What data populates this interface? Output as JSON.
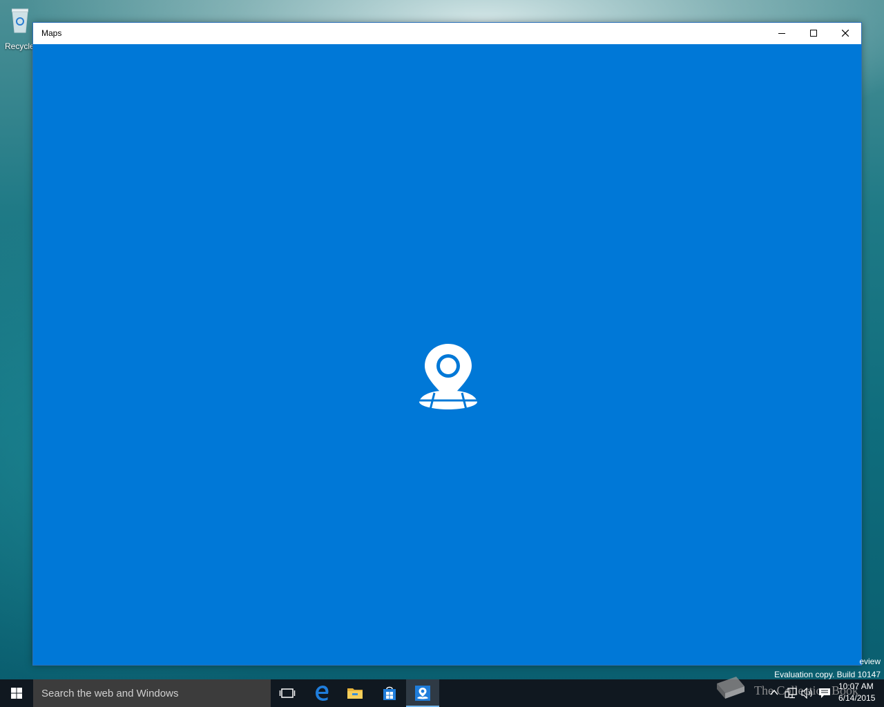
{
  "desktop": {
    "recycle_bin_label": "Recycle"
  },
  "window": {
    "title": "Maps",
    "caption_buttons": {
      "minimize_icon": "minimize-icon",
      "maximize_icon": "maximize-icon",
      "close_icon": "close-icon"
    },
    "splash_icon": "maps-logo-icon",
    "background_color": "#0078d7"
  },
  "watermark": {
    "edge_text": "eview",
    "build_text": "Evaluation copy. Build 10147"
  },
  "taskbar": {
    "search_placeholder": "Search the web and Windows",
    "pinned": [
      {
        "name": "Task View",
        "icon": "task-view-icon"
      },
      {
        "name": "Microsoft Edge",
        "icon": "edge-icon"
      },
      {
        "name": "File Explorer",
        "icon": "folder-icon"
      },
      {
        "name": "Store",
        "icon": "store-icon"
      },
      {
        "name": "Maps",
        "icon": "maps-icon",
        "active": true
      }
    ],
    "brand_watermark": "The Collection Book",
    "clock": {
      "time": "10:07 AM",
      "date": "6/14/2015"
    },
    "accent_color": "#76b9ed"
  }
}
